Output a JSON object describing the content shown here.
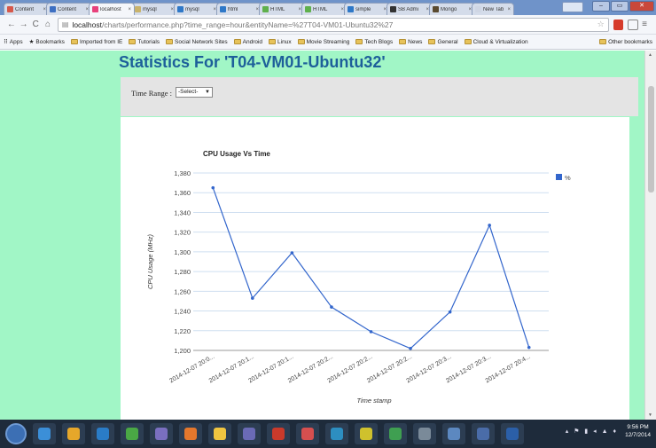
{
  "browser": {
    "tabs": [
      {
        "label": "Content",
        "color": "#d7584a"
      },
      {
        "label": "Content",
        "color": "#3d6fc2"
      },
      {
        "label": "localhost",
        "color": "#e8417b",
        "active": true
      },
      {
        "label": "mysql",
        "color": "#c9b36b"
      },
      {
        "label": "mysql",
        "color": "#2e78c8"
      },
      {
        "label": "html",
        "color": "#2e78c8"
      },
      {
        "label": "HTML",
        "color": "#5fb04c"
      },
      {
        "label": "HTML",
        "color": "#5fb04c"
      },
      {
        "label": "simple",
        "color": "#2e78c8"
      },
      {
        "label": "SB Admi",
        "color": "#333333"
      },
      {
        "label": "Mongo",
        "color": "#5a4a2f"
      },
      {
        "label": "New Tab",
        "color": "#cfd6e4"
      }
    ],
    "url_host": "localhost",
    "url_path": "/charts/performance.php?time_range=hour&entityName=%27T04-VM01-Ubuntu32%27",
    "bookmarks": [
      "Apps",
      "Bookmarks",
      "Imported from IE",
      "Tutorials",
      "Social Network Sites",
      "Android",
      "Linux",
      "Movie Streaming",
      "Tech Blogs",
      "News",
      "General",
      "Cloud & Virtualization"
    ],
    "other_bookmarks": "Other bookmarks"
  },
  "page": {
    "title": "Statistics For 'T04-VM01-Ubuntu32'",
    "time_range_label": "Time Range :",
    "time_range_value": "-Select-"
  },
  "chart_data": {
    "type": "line",
    "title": "CPU Usage Vs Time",
    "xlabel": "Time stamp",
    "ylabel": "CPU Usage (MHz)",
    "legend": "top-right",
    "ylim": [
      1200,
      1380
    ],
    "yticks": [
      1200,
      1220,
      1240,
      1260,
      1280,
      1300,
      1320,
      1340,
      1360,
      1380
    ],
    "categories": [
      "2014-12-07 20:0...",
      "2014-12-07 20:1...",
      "2014-12-07 20:1...",
      "2014-12-07 20:2...",
      "2014-12-07 20:2...",
      "2014-12-07 20:2...",
      "2014-12-07 20:3...",
      "2014-12-07 20:3...",
      "2014-12-07 20:4..."
    ],
    "series": [
      {
        "name": "%",
        "color": "#3366cc",
        "values": [
          1365,
          1253,
          1299,
          1244,
          1219,
          1202,
          1239,
          1327,
          1203
        ]
      }
    ],
    "grid": true
  },
  "taskbar": {
    "apps": [
      "#3b8fd8",
      "#e6a72a",
      "#2a7cc7",
      "#4aa845",
      "#7a6fc0",
      "#e4772c",
      "#f0c540",
      "#6a6ab6",
      "#c93a2b",
      "#d64f4f",
      "#2d8ec0",
      "#cfc12d",
      "#3f9f51",
      "#7a8a99",
      "#5c88c0",
      "#4a6ca8",
      "#2b5fa8"
    ],
    "time": "9:56 PM",
    "date": "12/7/2014"
  }
}
